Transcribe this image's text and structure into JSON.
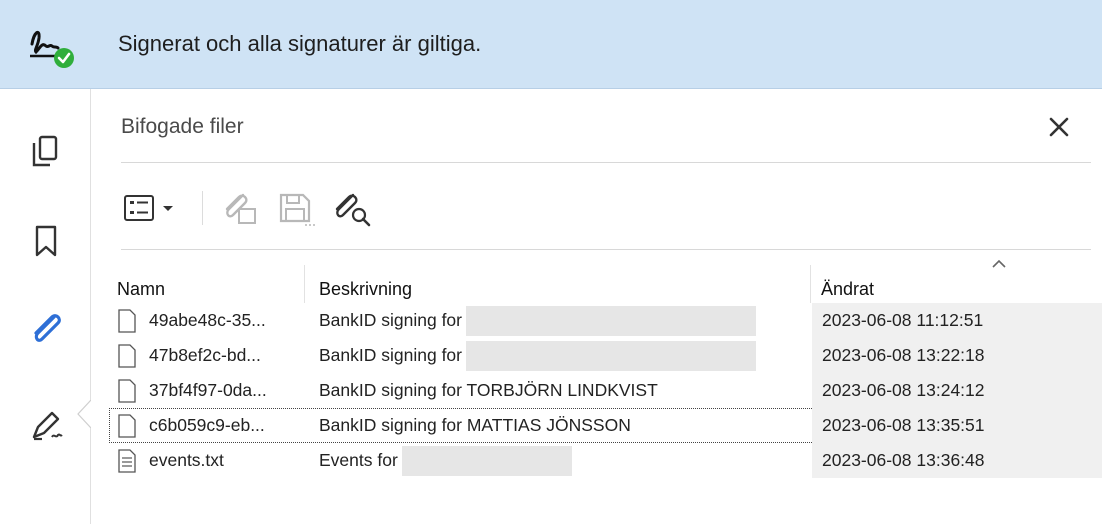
{
  "banner": {
    "text": "Signerat och alla signaturer är giltiga.",
    "icon": "signature-valid-icon"
  },
  "rail": {
    "items": [
      {
        "icon": "pages-icon"
      },
      {
        "icon": "bookmark-icon"
      },
      {
        "icon": "attachment-icon",
        "active": true
      },
      {
        "icon": "signature-pen-icon"
      }
    ]
  },
  "panel": {
    "title": "Bifogade filer",
    "close_icon": "close-icon"
  },
  "toolbar": {
    "items": [
      "options-menu-icon",
      "add-attachment-icon",
      "save-attachment-icon",
      "search-attachment-icon"
    ]
  },
  "table": {
    "columns": [
      "Namn",
      "Beskrivning",
      "Ändrat"
    ],
    "rows": [
      {
        "name": "49abe48c-35...",
        "description": "BankID signing for",
        "modified": "2023-06-08 11:12:51",
        "redacted": true
      },
      {
        "name": "47b8ef2c-bd...",
        "description": "BankID signing for",
        "modified": "2023-06-08 13:22:18",
        "redacted": true
      },
      {
        "name": "37bf4f97-0da...",
        "description": "BankID signing for TORBJÖRN LINDKVIST",
        "modified": "2023-06-08 13:24:12"
      },
      {
        "name": "c6b059c9-eb...",
        "description": "BankID signing for MATTIAS JÖNSSON",
        "modified": "2023-06-08 13:35:51",
        "focused": true
      },
      {
        "name": "events.txt",
        "description": "Events for",
        "modified": "2023-06-08 13:36:48",
        "redacted": true,
        "text_file": true
      }
    ]
  },
  "colors": {
    "banner_bg": "#cfe3f5",
    "accent_blue": "#2e6fd6",
    "valid_green": "#2fae3b"
  }
}
